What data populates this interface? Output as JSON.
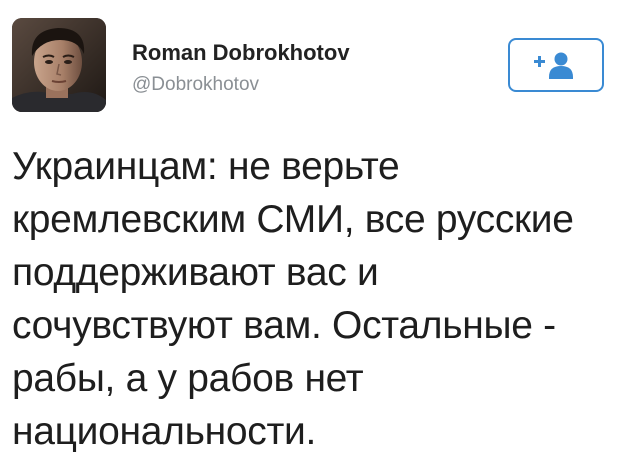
{
  "author": {
    "display_name": "Roman Dobrokhotov",
    "handle": "@Dobrokhotov",
    "avatar_icon": "profile-photo"
  },
  "follow_button": {
    "icon": "add-user-icon",
    "color": "#3a8ad3"
  },
  "tweet": {
    "lines": [
      "Украинцам: не верьте",
      "кремлевским СМИ, все русские",
      "поддерживают вас и",
      "сочувствуют вам. Остальные -",
      "рабы, а у рабов нет",
      "национальности."
    ]
  }
}
